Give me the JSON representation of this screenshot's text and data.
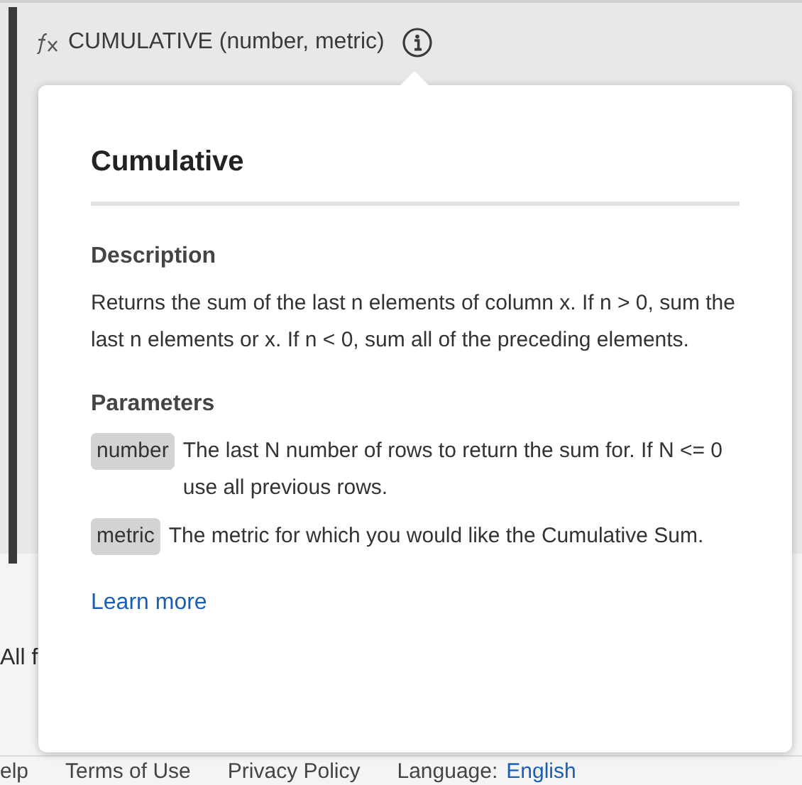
{
  "function_header": {
    "signature": "CUMULATIVE (number, metric)"
  },
  "background": {
    "partial_text": "All f",
    "footer_links": [
      {
        "label": "elp",
        "kind": "text"
      },
      {
        "label": "Terms of Use",
        "kind": "text"
      },
      {
        "label": "Privacy Policy",
        "kind": "text"
      },
      {
        "label": "Language:",
        "kind": "text"
      },
      {
        "label": "English",
        "kind": "link"
      }
    ]
  },
  "popover": {
    "title": "Cumulative",
    "description_heading": "Description",
    "description": "Returns the sum of the last n elements of column x. If n > 0, sum the last n elements or x. If n < 0, sum all of the preceding elements.",
    "parameters_heading": "Parameters",
    "parameters": [
      {
        "name": "number",
        "text": "The last N number of rows to return the sum for. If N <= 0 use all previous rows."
      },
      {
        "name": "metric",
        "text": "The metric for which you would like the Cumulative Sum."
      }
    ],
    "link": "Learn more"
  }
}
